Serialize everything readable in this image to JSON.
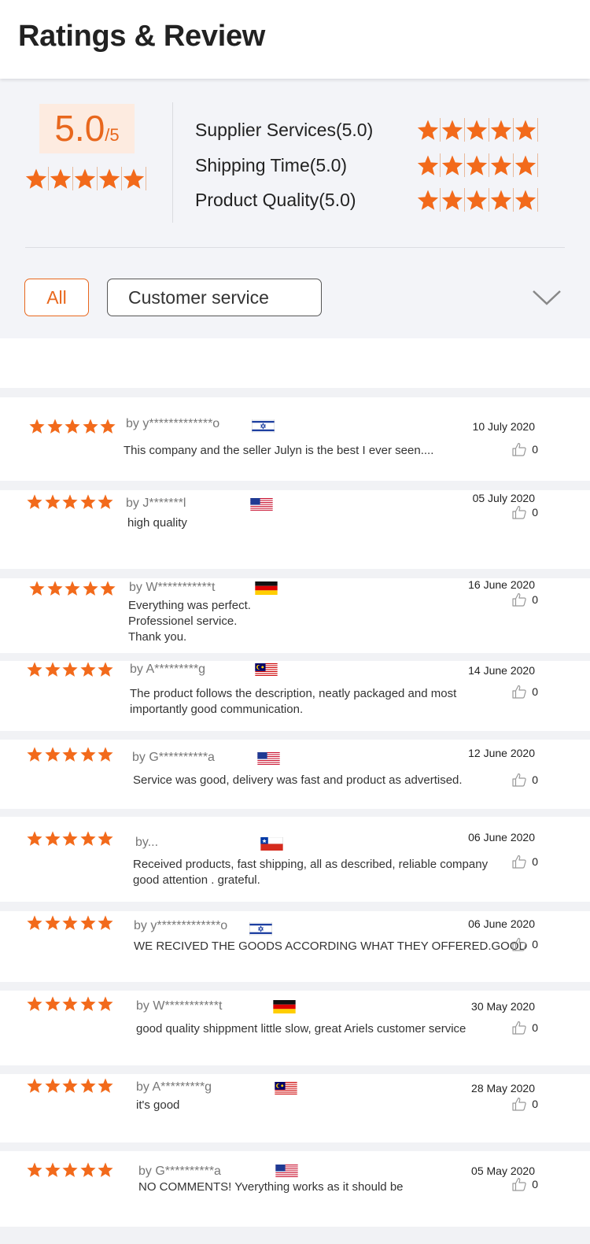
{
  "header": {
    "title": "Ratings & Review"
  },
  "summary": {
    "score": "5.0",
    "score_max": "/5",
    "overall_rating": 5,
    "criteria": [
      {
        "label": "Supplier Services(5.0)",
        "rating": 5
      },
      {
        "label": "Shipping Time(5.0)",
        "rating": 5
      },
      {
        "label": "Product Quality(5.0)",
        "rating": 5
      }
    ]
  },
  "filters": {
    "all_label": "All",
    "customer_service_label": "Customer service",
    "expand_icon": "chevron-down-icon"
  },
  "colors": {
    "accent": "#e8671d",
    "star": "#f26a1b",
    "background": "#f3f4f8"
  },
  "reviews": [
    {
      "rating": 5,
      "by": "by y*************o",
      "country_flag": "israel-flag",
      "date": "10 July 2020",
      "text": "This company and the seller  Julyn  is the best I ever seen....",
      "likes": "0"
    },
    {
      "rating": 5,
      "by": "by J*******l",
      "country_flag": "usa-flag",
      "date": "05 July 2020",
      "text": "high quality",
      "likes": "0"
    },
    {
      "rating": 5,
      "by": "by W***********t",
      "country_flag": "germany-flag",
      "date": "16 June 2020",
      "text": "Everything was perfect.\nProfessionel service.\nThank you.",
      "likes": "0"
    },
    {
      "rating": 5,
      "by": "by A*********g",
      "country_flag": "malaysia-flag",
      "date": "14 June 2020",
      "text": "The product follows the description, neatly packaged and most\nimportantly good communication.",
      "likes": "0"
    },
    {
      "rating": 5,
      "by": "by G**********a",
      "country_flag": "usa-flag",
      "date": "12 June 2020",
      "text": "Service was good, delivery was fast and product as advertised.",
      "likes": "0"
    },
    {
      "rating": 5,
      "by": "by...",
      "country_flag": "chile-flag",
      "date": "06 June 2020",
      "text": "Received products, fast shipping, all as described, reliable company\ngood attention . grateful.",
      "likes": "0"
    },
    {
      "rating": 5,
      "by": "by y*************o",
      "country_flag": "israel-flag",
      "date": "06 June 2020",
      "text": "WE RECIVED THE GOODS ACCORDING WHAT THEY OFFERED.GOOD",
      "likes": "0"
    },
    {
      "rating": 5,
      "by": "by W***********t",
      "country_flag": "germany-flag",
      "date": "30 May 2020",
      "text": "good quality shippment little slow, great Ariels customer service",
      "likes": "0"
    },
    {
      "rating": 5,
      "by": "by A*********g",
      "country_flag": "malaysia-flag",
      "date": "28 May 2020",
      "text": "it's good",
      "likes": "0"
    },
    {
      "rating": 5,
      "by": "by G**********a",
      "country_flag": "usa-flag",
      "date": "05 May 2020",
      "text": "NO COMMENTS! Yverything works as it should be",
      "likes": "0"
    }
  ]
}
